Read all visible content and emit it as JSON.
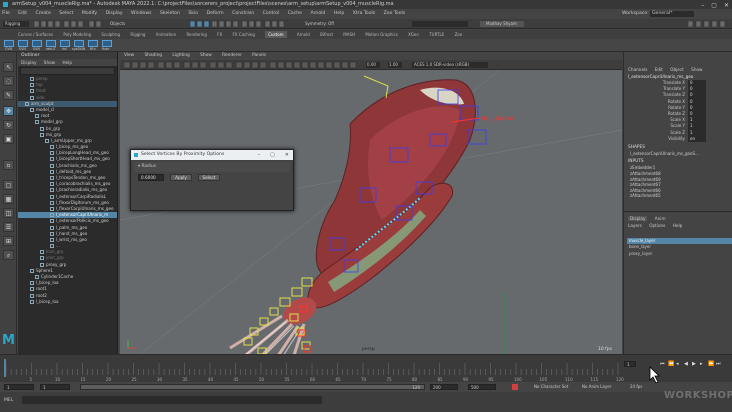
{
  "window": {
    "title": "armSetup_v004_muscleRig.ma* - Autodesk MAYA 2022.1: C:\\projectFiles\\sorcerers_project\\projectFiles\\scenes\\arm_setup\\armSetup_v004_muscleRig.ma",
    "min": "–",
    "max": "▢",
    "close": "✕"
  },
  "menubar": [
    "File",
    "Edit",
    "Create",
    "Select",
    "Modify",
    "Display",
    "Windows",
    "Skeleton",
    "Skin",
    "Deform",
    "Constrain",
    "Control",
    "Cache",
    "Arnold",
    "Help",
    "Xtra Tools",
    "Zoo Tools"
  ],
  "workspace": {
    "label": "Workspace:",
    "value": "General*"
  },
  "statusline": {
    "mode": "Rigging",
    "objects": "Objects",
    "symmetry": "Symmetry: Off",
    "user": "Madhav Shyam"
  },
  "shelf_tabs": {
    "items": [
      "Curves / Surfaces",
      "Poly Modeling",
      "Sculpting",
      "Rigging",
      "Animation",
      "Rendering",
      "FX",
      "FX Caching",
      "Custom",
      "Arnold",
      "Bifrost",
      "MASH",
      "Motion Graphics",
      "XGen",
      "TURTLE",
      "Zoo"
    ],
    "active": 8
  },
  "shelf_icons": [
    "CVN",
    "SVN",
    "SVN",
    "rebUT",
    "rbf",
    "sysSKIN",
    "tRn",
    "fixer"
  ],
  "outliner": {
    "title": "Outliner",
    "menu": [
      "Display",
      "Show",
      "Help"
    ],
    "rows": [
      {
        "label": "persp",
        "indent": 2,
        "style": "dim"
      },
      {
        "label": "top",
        "indent": 2,
        "style": "dim"
      },
      {
        "label": "front",
        "indent": 2,
        "style": "dim"
      },
      {
        "label": "side",
        "indent": 2,
        "style": "dim"
      },
      {
        "label": "arm_sculpt",
        "indent": 1,
        "style": "hl"
      },
      {
        "label": "model_cl",
        "indent": 2,
        "style": ""
      },
      {
        "label": "root",
        "indent": 3,
        "style": ""
      },
      {
        "label": "model_grp",
        "indent": 3,
        "style": ""
      },
      {
        "label": "bn_grp",
        "indent": 4,
        "style": ""
      },
      {
        "label": "ms_grp",
        "indent": 4,
        "style": ""
      },
      {
        "label": "l_armUpper_ms_grp",
        "indent": 5,
        "style": ""
      },
      {
        "label": "l_bicep_ms_geo",
        "indent": 6,
        "style": ""
      },
      {
        "label": "l_bicepLongHead_ms_geo",
        "indent": 6,
        "style": ""
      },
      {
        "label": "l_bicepShortHead_ms_geo",
        "indent": 6,
        "style": ""
      },
      {
        "label": "l_brachialis_ms_geo",
        "indent": 6,
        "style": ""
      },
      {
        "label": "l_deltoid_ms_geo",
        "indent": 6,
        "style": ""
      },
      {
        "label": "l_tricepsTendon_ms_geo",
        "indent": 6,
        "style": ""
      },
      {
        "label": "l_coracobrachialis_ms_geo",
        "indent": 6,
        "style": ""
      },
      {
        "label": "l_brachioradialis_ms_geo",
        "indent": 6,
        "style": ""
      },
      {
        "label": "l_extensorCarpiRadialisL",
        "indent": 6,
        "style": ""
      },
      {
        "label": "l_flexorDigitorum_ms_geo",
        "indent": 6,
        "style": ""
      },
      {
        "label": "l_flexorCarpiUlnaris_ms_geo",
        "indent": 6,
        "style": ""
      },
      {
        "label": "l_extensorCapriUlnaris_m",
        "indent": 6,
        "style": "sel"
      },
      {
        "label": "l_extensorPollicis_ms_geo",
        "indent": 6,
        "style": ""
      },
      {
        "label": "l_palm_ms_geo",
        "indent": 6,
        "style": ""
      },
      {
        "label": "l_hand_ms_geo",
        "indent": 6,
        "style": ""
      },
      {
        "label": "l_wrist_ms_geo",
        "indent": 6,
        "style": ""
      },
      {
        "label": "...",
        "indent": 6,
        "style": ""
      },
      {
        "label": "Icon_grp",
        "indent": 4,
        "style": "dim"
      },
      {
        "label": "joint_grp",
        "indent": 4,
        "style": "dim"
      },
      {
        "label": "proxy_grp",
        "indent": 4,
        "style": ""
      },
      {
        "label": "Sphere1",
        "indent": 2,
        "style": ""
      },
      {
        "label": "Cylinder1Cache",
        "indent": 3,
        "style": ""
      },
      {
        "label": "l_bicep_loa",
        "indent": 2,
        "style": ""
      },
      {
        "label": "root1",
        "indent": 2,
        "style": ""
      },
      {
        "label": "root2",
        "indent": 2,
        "style": ""
      },
      {
        "label": "l_bicep_loa",
        "indent": 2,
        "style": ""
      }
    ]
  },
  "viewport": {
    "menu": [
      "View",
      "Shading",
      "Lighting",
      "Show",
      "Renderer",
      "Panels"
    ],
    "field_a": "0.00",
    "field_b": "1.00",
    "colorspace": "ACES 1.0 SDR-video (sRGB)",
    "camera": "persp",
    "fps": "10 fps",
    "annotation": "Rc_L_UpCurl"
  },
  "dialog": {
    "title": "Select Vertices By Proximity Options",
    "frame_label": "Radius",
    "radius_value": "0.6000",
    "apply": "Apply",
    "select": "Select",
    "min": "–",
    "max": "▢",
    "close": "✕"
  },
  "channelbox": {
    "tabs": [
      "Channels",
      "Edit",
      "Object",
      "Show"
    ],
    "object": "l_extensorCapriUlnaris_ms_geo",
    "attrs": [
      {
        "name": "Translate X",
        "value": "0"
      },
      {
        "name": "Translate Y",
        "value": "0"
      },
      {
        "name": "Translate Z",
        "value": "0"
      },
      {
        "name": "Rotate X",
        "value": "0"
      },
      {
        "name": "Rotate Y",
        "value": "0"
      },
      {
        "name": "Rotate Z",
        "value": "0"
      },
      {
        "name": "Scale X",
        "value": "1"
      },
      {
        "name": "Scale Y",
        "value": "1"
      },
      {
        "name": "Scale Z",
        "value": "1"
      },
      {
        "name": "Visibility",
        "value": "on"
      }
    ],
    "shapes_label": "SHAPES",
    "shape": "l_extensorCapriUlnaris_ms_geoS...",
    "inputs_label": "INPUTS",
    "inputs": [
      "zEmbedder1",
      "zAttachment68",
      "zAttachment69",
      "zAttachment67",
      "zAttachment66",
      "zAttachment65"
    ],
    "layer_tabs": [
      "Display",
      "Anim"
    ],
    "layer_menu": [
      "Layers",
      "Options",
      "Help"
    ],
    "layers": [
      {
        "name": "muscle_layer",
        "selected": true
      },
      {
        "name": "bone_layer",
        "selected": false
      },
      {
        "name": "proxy_layer",
        "selected": false
      }
    ]
  },
  "timeline": {
    "ticks": [
      "5",
      "10",
      "15",
      "20",
      "25",
      "30",
      "35",
      "40",
      "45",
      "50",
      "55",
      "60",
      "65",
      "70",
      "75",
      "80",
      "85",
      "90",
      "95",
      "100",
      "105",
      "110",
      "115",
      "120"
    ],
    "current": "1"
  },
  "range": {
    "start": "1",
    "playstart": "1",
    "range_label": "120",
    "end_a": "120",
    "end_b": "200",
    "end_c": "500",
    "character_set": "No Character Set",
    "anim_layer": "No Anim Layer",
    "fps": "24 fps"
  },
  "cmdline": {
    "lang": "MEL"
  },
  "watermark": "WORKSHOP",
  "colors": {
    "accent": "#5285a6",
    "muscle": "#9a3c3c",
    "joint": "#3a3cf0",
    "control": "#e0e04a",
    "background": "#666a6d"
  }
}
